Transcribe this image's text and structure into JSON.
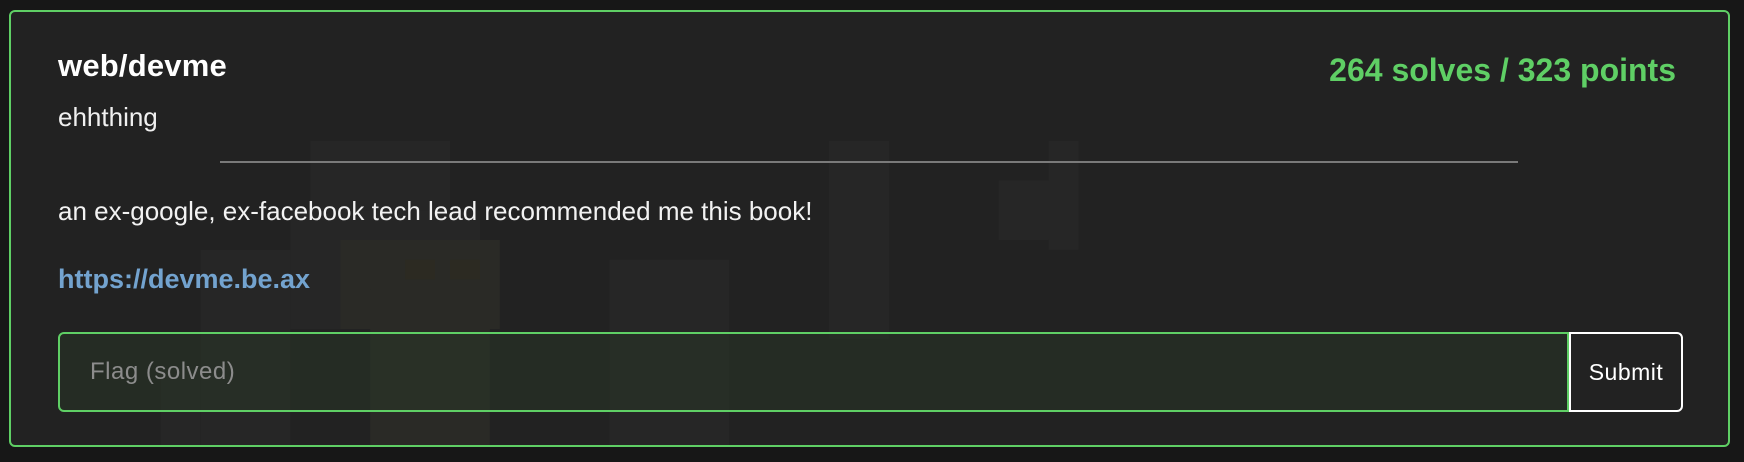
{
  "challenge": {
    "title": "web/devme",
    "author": "ehhthing",
    "score": "264 solves / 323 points",
    "description": "an ex-google, ex-facebook tech lead recommended me this book!",
    "link": "https://devme.be.ax"
  },
  "flag_form": {
    "placeholder": "Flag (solved)",
    "value": "",
    "submit_label": "Submit"
  },
  "colors": {
    "accent": "#5fcf65",
    "link": "#73a3cf",
    "card_bg": "#222222",
    "page_bg": "#171717"
  }
}
